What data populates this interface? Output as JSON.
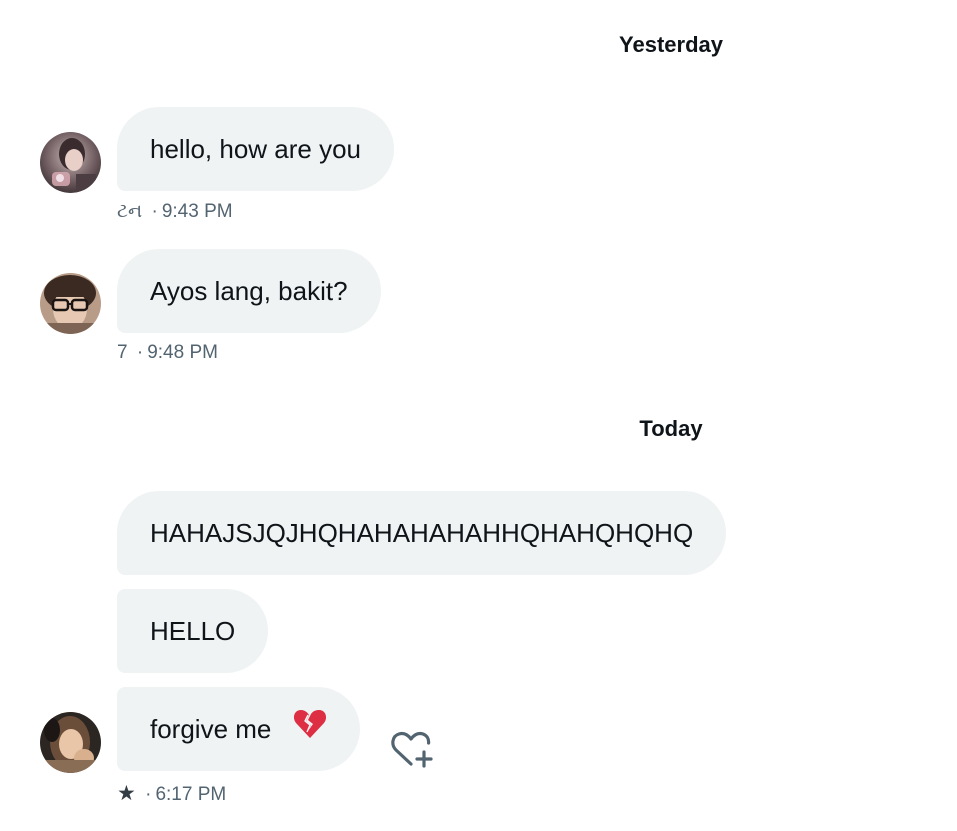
{
  "day_separators": {
    "yesterday": "Yesterday",
    "today": "Today"
  },
  "messages": [
    {
      "text": "hello, how are you",
      "meta_prefix": "ટન",
      "time": "9:43 PM"
    },
    {
      "text": "Ayos lang, bakit?",
      "meta_prefix": "7",
      "time": "9:48 PM"
    },
    {
      "text": "HAHAJSJQJHQHAHAHAHAHHQHAHQHQHQ"
    },
    {
      "text": "HELLO"
    },
    {
      "text": "forgive me",
      "emoji": "broken-heart",
      "meta_prefix": "★",
      "time": "6:17 PM"
    }
  ],
  "separator_dot": "·",
  "icons": {
    "add_reaction": "heart-plus-icon",
    "broken_heart": "broken-heart-icon",
    "star": "star-icon"
  }
}
